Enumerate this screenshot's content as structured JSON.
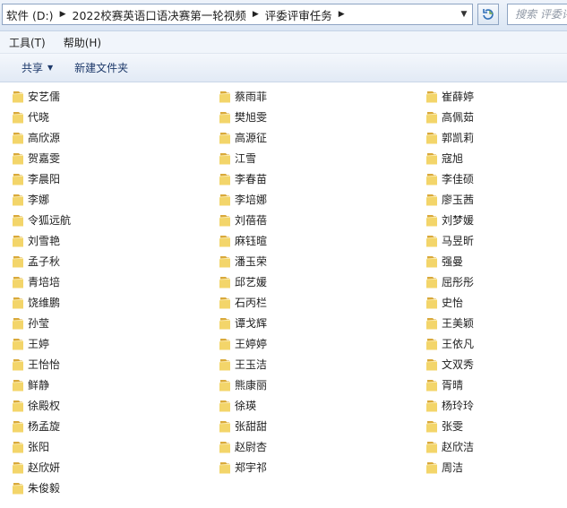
{
  "address_bar": {
    "breadcrumbs": [
      "软件 (D:)",
      "2022校赛英语口语决赛第一轮视频",
      "评委评审任务"
    ],
    "search_placeholder": "搜索 评委评..."
  },
  "menu": {
    "items": [
      "工具(T)",
      "帮助(H)"
    ]
  },
  "commands": {
    "share_label": "共享",
    "new_folder_label": "新建文件夹"
  },
  "folders": {
    "columns": [
      [
        "安艺儒",
        "代晓",
        "高欣源",
        "贺嘉雯",
        "李晨阳",
        "李娜",
        "令狐远航",
        "刘雪艳",
        "孟子秋",
        "青培培",
        "饶维鹏",
        "孙莹",
        "王婷",
        "王怡怡",
        "鲜静",
        "徐殿权",
        "杨孟旋",
        "张阳",
        "赵欣妍",
        "朱俊毅"
      ],
      [
        "蔡雨菲",
        "樊旭雯",
        "高源征",
        "江雪",
        "李春苗",
        "李培娜",
        "刘蓓蓓",
        "麻钰暄",
        "潘玉荣",
        "邱艺媛",
        "石丙栏",
        "谭戈辉",
        "王婷婷",
        "王玉洁",
        "熊康丽",
        "徐瑛",
        "张甜甜",
        "赵尉杏",
        "郑宇祁"
      ],
      [
        "崔薛婷",
        "高佩茹",
        "郭凯莉",
        "寇旭",
        "李佳硕",
        "廖玉茜",
        "刘梦媛",
        "马昱昕",
        "强曼",
        "屈彤彤",
        "史怡",
        "王美颖",
        "王依凡",
        "文双秀",
        "胥晴",
        "杨玲玲",
        "张雯",
        "赵欣洁",
        "周洁"
      ]
    ]
  },
  "colors": {
    "folder_front": "#f3d56a",
    "folder_back": "#d9a93a",
    "chrome_blue": "#dbe6f4"
  }
}
